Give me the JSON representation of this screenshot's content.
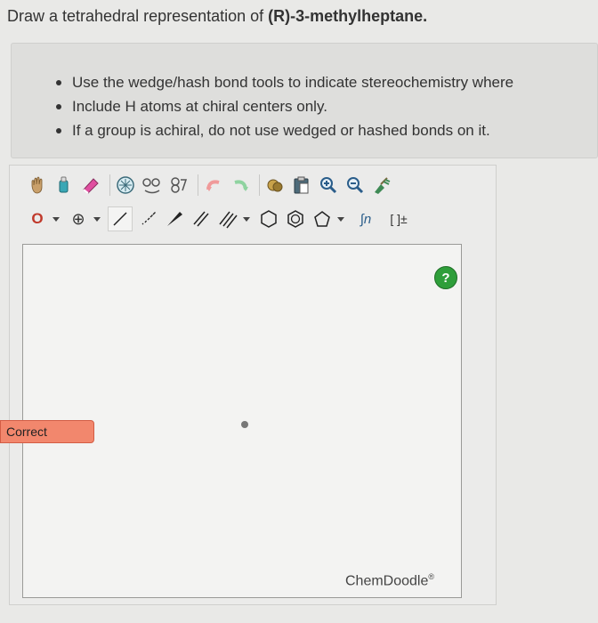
{
  "question": {
    "prefix": "Draw a tetrahedral representation of ",
    "compound": "(R)-3-methylheptane."
  },
  "instructions": [
    "Use the wedge/hash bond tools to indicate stereochemistry where",
    "Include H atoms at chiral centers only.",
    "If a group is achiral, do not use wedged or hashed bonds on it."
  ],
  "toolbar": {
    "atom_label": "O",
    "charge_symbol": "⊕",
    "template_label": "∫n",
    "bracket_label": "[ ]±"
  },
  "canvas": {
    "help_label": "?",
    "brand": "ChemDoodle",
    "brand_mark": "®"
  },
  "status": {
    "result": "Correct"
  },
  "colors": {
    "accent_red": "#c0392b",
    "help_green": "#2e9e3a",
    "badge": "#f2876d"
  }
}
